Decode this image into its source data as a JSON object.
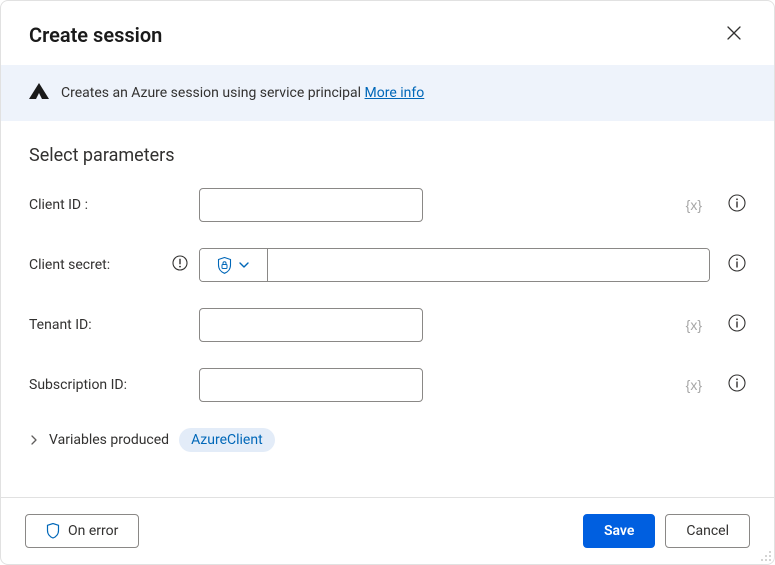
{
  "header": {
    "title": "Create session"
  },
  "banner": {
    "text": "Creates an Azure session using service principal ",
    "link": "More info"
  },
  "section_title": "Select parameters",
  "params": {
    "client_id": {
      "label": "Client ID :",
      "value": "",
      "var_hint": "{x}"
    },
    "client_secret": {
      "label": "Client secret:",
      "value": ""
    },
    "tenant_id": {
      "label": "Tenant ID:",
      "value": "",
      "var_hint": "{x}"
    },
    "subscription_id": {
      "label": "Subscription ID:",
      "value": "",
      "var_hint": "{x}"
    }
  },
  "vars_produced": {
    "label": "Variables produced",
    "pill": "AzureClient"
  },
  "footer": {
    "on_error": "On error",
    "save": "Save",
    "cancel": "Cancel"
  }
}
